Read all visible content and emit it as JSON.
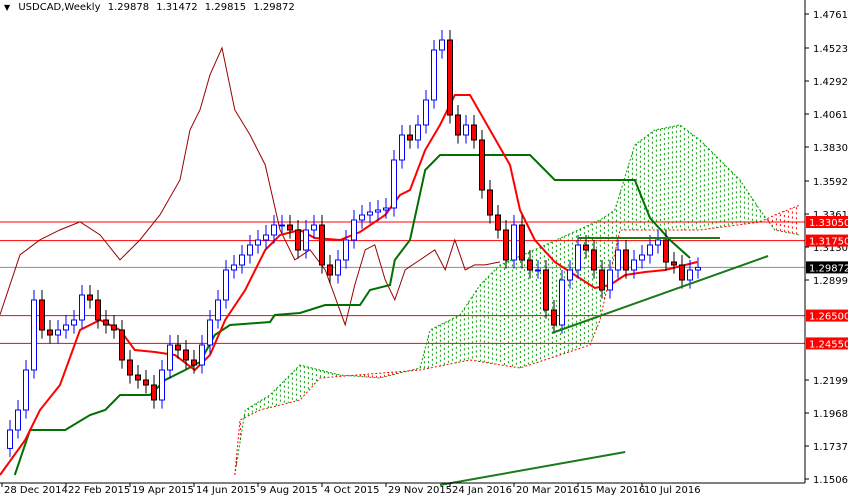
{
  "header": {
    "symbol": "USDCAD,Weekly",
    "open": "1.29878",
    "high": "1.31472",
    "low": "1.29815",
    "close": "1.29872"
  },
  "chart_data": {
    "type": "candlestick",
    "title": "USDCAD,Weekly",
    "ylim": [
      1.1478,
      1.4859
    ],
    "xlim_weeks": [
      -0.25,
      100.4
    ],
    "y_ticks": [
      "1.47610",
      "1.45230",
      "1.42920",
      "1.40610",
      "1.38300",
      "1.35920",
      "1.33610",
      "1.31300",
      "1.28990",
      "1.21990",
      "1.19680",
      "1.17370",
      "1.15060"
    ],
    "x_ticks": [
      {
        "label": "28 Dec 2014",
        "week": 0
      },
      {
        "label": "22 Feb 2015",
        "week": 8
      },
      {
        "label": "19 Apr 2015",
        "week": 16
      },
      {
        "label": "14 Jun 2015",
        "week": 24
      },
      {
        "label": "9 Aug 2015",
        "week": 32
      },
      {
        "label": "4 Oct 2015",
        "week": 40
      },
      {
        "label": "29 Nov 2015",
        "week": 48
      },
      {
        "label": "24 Jan 2016",
        "week": 56
      },
      {
        "label": "20 Mar 2016",
        "week": 64
      },
      {
        "label": "15 May 2016",
        "week": 72
      },
      {
        "label": "10 Jul 2016",
        "week": 80
      }
    ],
    "first_candle_week": 1,
    "first_open": 1.172,
    "closes": [
      1.1849,
      1.1989,
      1.2269,
      1.2759,
      1.2549,
      1.2514,
      1.2549,
      1.2584,
      1.2619,
      1.2794,
      1.2759,
      1.2619,
      1.2584,
      1.2549,
      1.2339,
      1.2234,
      1.2199,
      1.2164,
      1.2059,
      1.2269,
      1.2444,
      1.2409,
      1.2339,
      1.2304,
      1.2444,
      1.2619,
      1.2759,
      1.2969,
      1.3004,
      1.3074,
      1.3144,
      1.3179,
      1.3214,
      1.3284,
      1.3284,
      1.3249,
      1.3109,
      1.3249,
      1.3284,
      1.3004,
      1.2934,
      1.3039,
      1.3179,
      1.3319,
      1.3354,
      1.3375,
      1.3389,
      1.3403,
      1.3739,
      1.3914,
      1.3879,
      1.3984,
      1.4159,
      1.4509,
      1.4579,
      1.4054,
      1.3914,
      1.3984,
      1.3879,
      1.3529,
      1.3354,
      1.3249,
      1.3039,
      1.3284,
      1.3039,
      1.2969,
      1.2969,
      1.2689,
      1.2584,
      1.2899,
      1.2969,
      1.3144,
      1.3109,
      1.2969,
      1.2829,
      1.2969,
      1.3109,
      1.2969,
      1.3039,
      1.3074,
      1.3144,
      1.3179,
      1.3025,
      1.3004,
      1.2899,
      1.2969,
      1.2987
    ],
    "tenkan_sen": [
      [
        -0.25,
        1.1534
      ],
      [
        2.9,
        1.1779
      ],
      [
        4.75,
        1.1989
      ],
      [
        7.25,
        1.2164
      ],
      [
        9.75,
        1.2549
      ],
      [
        12.25,
        1.2619
      ],
      [
        14.75,
        1.2549
      ],
      [
        16.6,
        1.2409
      ],
      [
        19.1,
        1.2395
      ],
      [
        21.6,
        1.2374
      ],
      [
        24.1,
        1.2269
      ],
      [
        26,
        1.2374
      ],
      [
        27.9,
        1.2619
      ],
      [
        30.4,
        1.2829
      ],
      [
        32.9,
        1.3109
      ],
      [
        34.75,
        1.3214
      ],
      [
        37.25,
        1.3249
      ],
      [
        39.1,
        1.3193
      ],
      [
        42.25,
        1.3179
      ],
      [
        44.75,
        1.3235
      ],
      [
        47.9,
        1.3354
      ],
      [
        49.75,
        1.3494
      ],
      [
        51,
        1.3529
      ],
      [
        52.9,
        1.3809
      ],
      [
        54.75,
        1.3984
      ],
      [
        56.6,
        1.4194
      ],
      [
        58.5,
        1.4194
      ],
      [
        61,
        1.3949
      ],
      [
        63.5,
        1.3704
      ],
      [
        64.75,
        1.3389
      ],
      [
        66.6,
        1.3179
      ],
      [
        69.1,
        1.3025
      ],
      [
        71.6,
        1.2934
      ],
      [
        74.1,
        1.2843
      ],
      [
        76,
        1.2864
      ],
      [
        77.9,
        1.2934
      ],
      [
        80.4,
        1.2955
      ],
      [
        82.9,
        1.2969
      ],
      [
        85.4,
        1.3004
      ],
      [
        86.9,
        1.3025
      ]
    ],
    "kijun_sen": [
      [
        1.6,
        1.1534
      ],
      [
        3.5,
        1.1849
      ],
      [
        7.9,
        1.1849
      ],
      [
        11,
        1.1954
      ],
      [
        12.9,
        1.1989
      ],
      [
        14.75,
        1.2094
      ],
      [
        18.5,
        1.2094
      ],
      [
        20.4,
        1.2199
      ],
      [
        22.9,
        1.2269
      ],
      [
        24.75,
        1.2325
      ],
      [
        26.6,
        1.2514
      ],
      [
        28.5,
        1.2584
      ],
      [
        33.5,
        1.2605
      ],
      [
        34.1,
        1.2654
      ],
      [
        37.25,
        1.2668
      ],
      [
        40.4,
        1.2724
      ],
      [
        44.75,
        1.2724
      ],
      [
        46,
        1.2829
      ],
      [
        48.5,
        1.2864
      ],
      [
        49.1,
        1.3039
      ],
      [
        51,
        1.3179
      ],
      [
        52.9,
        1.3669
      ],
      [
        54.75,
        1.3774
      ],
      [
        66,
        1.3774
      ],
      [
        69.1,
        1.3599
      ],
      [
        79.1,
        1.3599
      ],
      [
        81,
        1.3333
      ],
      [
        83.5,
        1.3179
      ],
      [
        86,
        1.3053
      ]
    ],
    "chikou_span": [
      [
        -0.25,
        1.2656
      ],
      [
        2.25,
        1.3075
      ],
      [
        4.75,
        1.318
      ],
      [
        7.25,
        1.325
      ],
      [
        9.75,
        1.3306
      ],
      [
        12.25,
        1.3215
      ],
      [
        14.75,
        1.304
      ],
      [
        17.25,
        1.318
      ],
      [
        19.75,
        1.3355
      ],
      [
        22.25,
        1.36
      ],
      [
        23.5,
        1.395
      ],
      [
        24.75,
        1.409
      ],
      [
        26,
        1.4335
      ],
      [
        27.5,
        1.4524
      ],
      [
        29.1,
        1.409
      ],
      [
        31,
        1.3915
      ],
      [
        32.9,
        1.3705
      ],
      [
        34.75,
        1.325
      ],
      [
        36.6,
        1.304
      ],
      [
        38.5,
        1.311
      ],
      [
        40.4,
        1.297
      ],
      [
        42.9,
        1.2585
      ],
      [
        44.1,
        1.2865
      ],
      [
        45.4,
        1.311
      ],
      [
        46.6,
        1.3145
      ],
      [
        47.9,
        1.29
      ],
      [
        49.1,
        1.276
      ],
      [
        50.4,
        1.297
      ],
      [
        52.25,
        1.304
      ],
      [
        54.1,
        1.311
      ],
      [
        55.4,
        1.297
      ],
      [
        56.6,
        1.318
      ],
      [
        57.9,
        1.297
      ],
      [
        59.1,
        1.3005
      ],
      [
        60.4,
        1.3005
      ],
      [
        62.25,
        1.3026
      ]
    ],
    "senkou_span_a": [
      [
        29.1,
        1.1534
      ],
      [
        30.4,
        1.1989
      ],
      [
        33.5,
        1.2094
      ],
      [
        37.25,
        1.2304
      ],
      [
        42.25,
        1.2234
      ],
      [
        47.25,
        1.2213
      ],
      [
        52.25,
        1.2283
      ],
      [
        53.5,
        1.2549
      ],
      [
        57.25,
        1.2654
      ],
      [
        59.75,
        1.2864
      ],
      [
        62.25,
        1.3004
      ],
      [
        67.9,
        1.3144
      ],
      [
        74.75,
        1.3319
      ],
      [
        76.6,
        1.3389
      ],
      [
        79.1,
        1.3844
      ],
      [
        81.6,
        1.3949
      ],
      [
        84.75,
        1.3984
      ],
      [
        87.25,
        1.3879
      ],
      [
        89.75,
        1.3739
      ],
      [
        92.25,
        1.3599
      ],
      [
        94.75,
        1.3389
      ],
      [
        96.6,
        1.3249
      ],
      [
        99.75,
        1.3214
      ]
    ],
    "senkou_span_b": [
      [
        29.1,
        1.1534
      ],
      [
        29.75,
        1.1919
      ],
      [
        32.25,
        1.1989
      ],
      [
        37.25,
        1.2059
      ],
      [
        39.75,
        1.2213
      ],
      [
        52.25,
        1.2269
      ],
      [
        58.5,
        1.2339
      ],
      [
        64.75,
        1.2283
      ],
      [
        69.75,
        1.2374
      ],
      [
        73.5,
        1.2444
      ],
      [
        74.75,
        1.2619
      ],
      [
        77.25,
        1.3249
      ],
      [
        87.25,
        1.3249
      ],
      [
        94.75,
        1.3305
      ],
      [
        96.6,
        1.3354
      ],
      [
        99.75,
        1.3424
      ]
    ],
    "levels": [
      {
        "price": 1.3305,
        "label": "1.33050"
      },
      {
        "price": 1.3175,
        "label": "1.31750"
      },
      {
        "price": 1.265,
        "label": "1.26500"
      },
      {
        "price": 1.2455,
        "label": "1.24550"
      }
    ],
    "current_price": {
      "price": 1.29872,
      "label": "1.29872"
    },
    "trendlines": [
      {
        "name": "rising-support",
        "from": [
          68.75,
          1.2528
        ],
        "to": [
          95.75,
          1.3067
        ]
      },
      {
        "name": "range-top",
        "from": [
          72,
          1.3193
        ],
        "to": [
          89.75,
          1.3193
        ]
      },
      {
        "name": "lower-trendline",
        "from": [
          54.75,
          1.1464
        ],
        "to": [
          77.9,
          1.1695
        ]
      }
    ],
    "colors": {
      "bull": "#0000ff",
      "bear": "#ff0000",
      "tenkan": "#ff0000",
      "kijun": "#007000",
      "chikou": "#990000",
      "cloud_up": "#00a000",
      "cloud_down": "#ff0000",
      "level": "#ff0000",
      "trend": "#1a7a1a"
    }
  }
}
